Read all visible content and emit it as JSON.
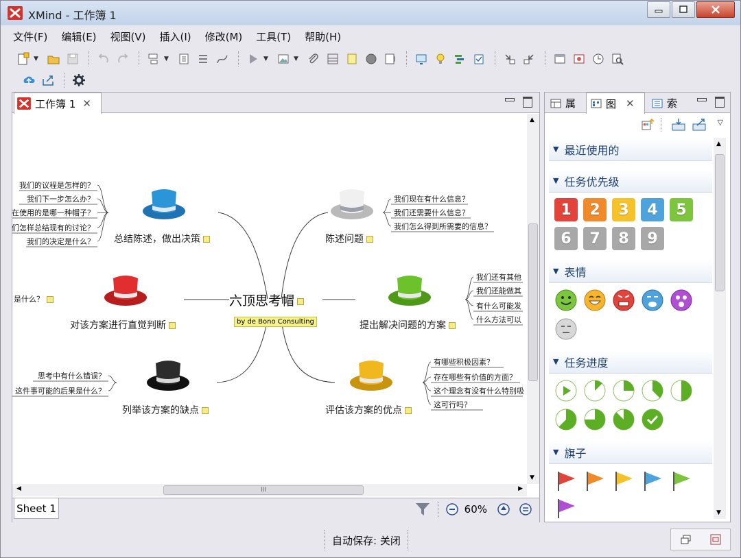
{
  "window": {
    "title": "XMind - 工作簿 1"
  },
  "menu": [
    "文件(F)",
    "编辑(E)",
    "视图(V)",
    "插入(I)",
    "修改(M)",
    "工具(T)",
    "帮助(H)"
  ],
  "toolbar": {
    "row1_icons": [
      "new-workbook-icon",
      "open-folder-icon",
      "save-icon",
      "undo-icon",
      "redo-icon",
      "insert-topic-icon",
      "insert-subtopic-icon",
      "list-icon",
      "relationship-icon",
      "presentation-icon",
      "image-icon",
      "attachment-icon",
      "boundary-icon",
      "note-icon",
      "marker-icon",
      "summary-icon",
      "screen-icon",
      "idea-icon",
      "gantt-icon",
      "task-icon",
      "drill-down-icon",
      "drill-up-icon",
      "window-icon",
      "layout-icon",
      "clock-icon",
      "search-icon"
    ],
    "row2_icons": [
      "upload-icon",
      "share-icon",
      "settings-icon"
    ]
  },
  "editor": {
    "tab_label": "工作簿 1",
    "sheet_tab": "Sheet 1",
    "zoom": "60%"
  },
  "mindmap": {
    "central": {
      "title": "六顶思考帽",
      "subtitle": "by de Bono Consulting"
    },
    "branches": [
      {
        "hat": "blue",
        "label": "总结陈述，做出决策",
        "leaves": [
          "我们的议程是怎样的？",
          "我们下一步怎么办？",
          "在使用的是哪一种帽子？",
          "我们怎样总结现有的讨论？",
          "我们的决定是什么？"
        ]
      },
      {
        "hat": "white",
        "label": "陈述问题",
        "leaves": [
          "我们现在有什么信息？",
          "我们还需要什么信息？",
          "我们怎么得到所需要的信息？"
        ]
      },
      {
        "hat": "red",
        "label": "对该方案进行直觉判断",
        "leaves": [
          "是什么？"
        ]
      },
      {
        "hat": "green",
        "label": "提出解决问题的方案",
        "leaves": [
          "我们还有其他",
          "我们还能做其",
          "有什么可能发",
          "什么方法可以"
        ]
      },
      {
        "hat": "black",
        "label": "列举该方案的缺点",
        "leaves": [
          "思考中有什么错误？",
          "这件事可能的后果是什么？"
        ]
      },
      {
        "hat": "yellow",
        "label": "评估该方案的优点",
        "leaves": [
          "有哪些积极因素？",
          "存在哪些有价值的方面？",
          "这个理念有没有什么特别吸",
          "这可行吗？"
        ]
      }
    ]
  },
  "right_panel": {
    "tabs": [
      "属",
      "图",
      "索"
    ],
    "sections": [
      {
        "title": "最近使用的"
      },
      {
        "title": "任务优先级",
        "priorities": [
          {
            "label": "1",
            "color": "#e2433b"
          },
          {
            "label": "2",
            "color": "#f08a2a"
          },
          {
            "label": "3",
            "color": "#f6c22a"
          },
          {
            "label": "4",
            "color": "#4ea3dd"
          },
          {
            "label": "5",
            "color": "#7cc53d"
          },
          {
            "label": "6",
            "color": "#a8a8a8"
          },
          {
            "label": "7",
            "color": "#a8a8a8"
          },
          {
            "label": "8",
            "color": "#a8a8a8"
          },
          {
            "label": "9",
            "color": "#a8a8a8"
          }
        ]
      },
      {
        "title": "表情",
        "faces": [
          "smile-icon",
          "laugh-icon",
          "angry-icon",
          "cry-icon",
          "surprise-icon",
          "boring-icon"
        ]
      },
      {
        "title": "任务进度",
        "progress": [
          0,
          0.125,
          0.25,
          0.375,
          0.5,
          0.625,
          0.75,
          0.875,
          1
        ]
      },
      {
        "title": "旗子",
        "flags": [
          "#e2433b",
          "#f08a2a",
          "#f6c22a",
          "#4ea3dd",
          "#7cc53d",
          "#b04fd4"
        ]
      }
    ]
  },
  "status": {
    "autosave": "自动保存: 关闭"
  },
  "colors": {
    "blue_hat": "#2a86c8",
    "white_hat": "#d8d8d8",
    "red_hat": "#d42a2a",
    "green_hat": "#5aac1e",
    "black_hat": "#222222",
    "yellow_hat": "#e2ac1a"
  }
}
